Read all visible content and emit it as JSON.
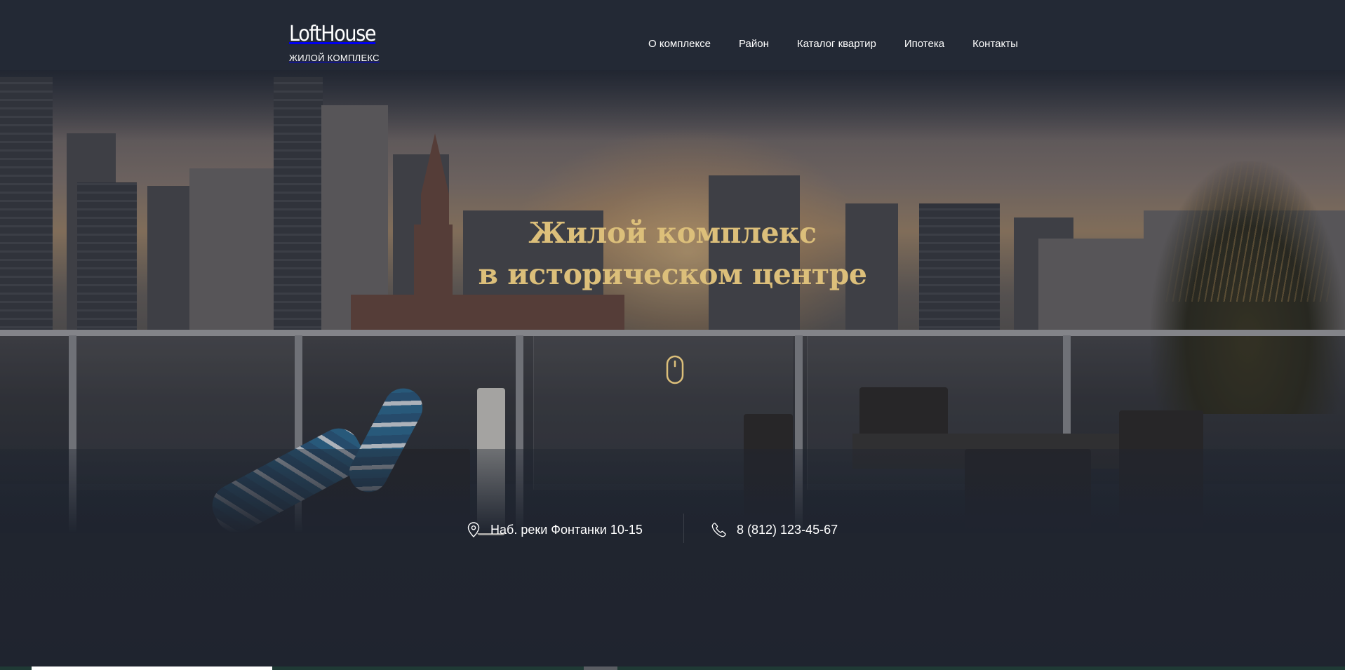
{
  "header": {
    "logo_title": "LoftHouse",
    "logo_subtitle": "ЖИЛОЙ КОМПЛЕКС",
    "nav": [
      {
        "label": "О комплексе"
      },
      {
        "label": "Район"
      },
      {
        "label": "Каталог квартир"
      },
      {
        "label": "Ипотека"
      },
      {
        "label": "Контакты"
      }
    ]
  },
  "hero": {
    "title_line1": "Жилой комплекс",
    "title_line2": "в историческом центре",
    "scroll_icon": "mouse-icon"
  },
  "contacts": {
    "address": "Наб. реки Фонтанки 10-15",
    "address_icon": "map-pin-icon",
    "phone": "8 (812) 123-45-67",
    "phone_icon": "phone-icon"
  },
  "colors": {
    "background": "#232935",
    "accent_gold": "#dcbf7a",
    "text": "#ffffff"
  }
}
